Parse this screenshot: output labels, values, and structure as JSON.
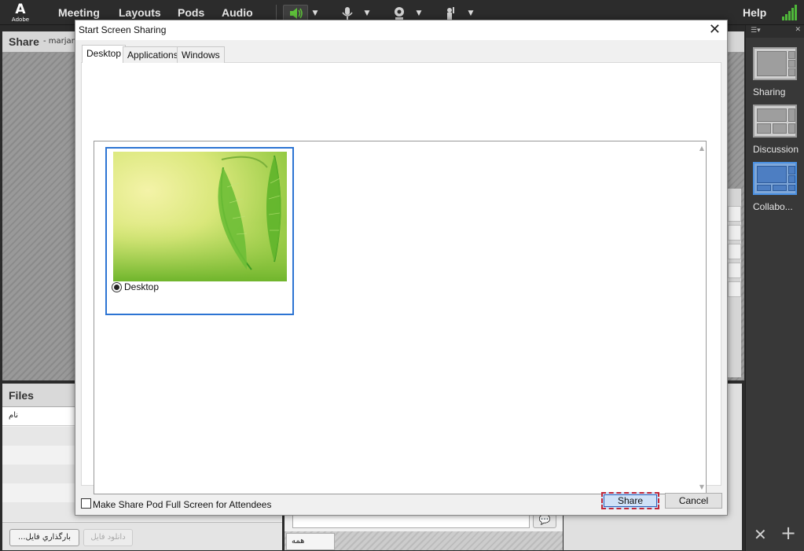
{
  "menubar": {
    "logo_text": "Adobe",
    "items": [
      "Meeting",
      "Layouts",
      "Pods",
      "Audio"
    ],
    "help": "Help",
    "icons": [
      "speaker-icon",
      "microphone-icon",
      "webcam-icon",
      "raise-hand-icon"
    ],
    "accent_green": "#4fb83a"
  },
  "share_pod": {
    "title": "Share",
    "subtitle": "- marjan"
  },
  "files_pod": {
    "title": "Files",
    "column": "نام",
    "upload_button": "...بارگذاري فايل",
    "download_button": "دانلود فايل"
  },
  "chat_pod": {
    "tab": "همه"
  },
  "sidebar": {
    "layouts": [
      {
        "label": "Sharing",
        "selected": false
      },
      {
        "label": "Discussion",
        "selected": false
      },
      {
        "label": "Collabo...",
        "selected": true
      }
    ]
  },
  "dialog": {
    "title": "Start Screen Sharing",
    "tabs": [
      "Desktop",
      "Applications",
      "Windows"
    ],
    "active_tab": "Desktop",
    "items": [
      {
        "label": "Desktop",
        "selected": true
      }
    ],
    "fullscreen_checkbox": "Make Share Pod Full Screen for Attendees",
    "fullscreen_checked": false,
    "share_button": "Share",
    "cancel_button": "Cancel",
    "selection_color": "#2c74d3"
  }
}
